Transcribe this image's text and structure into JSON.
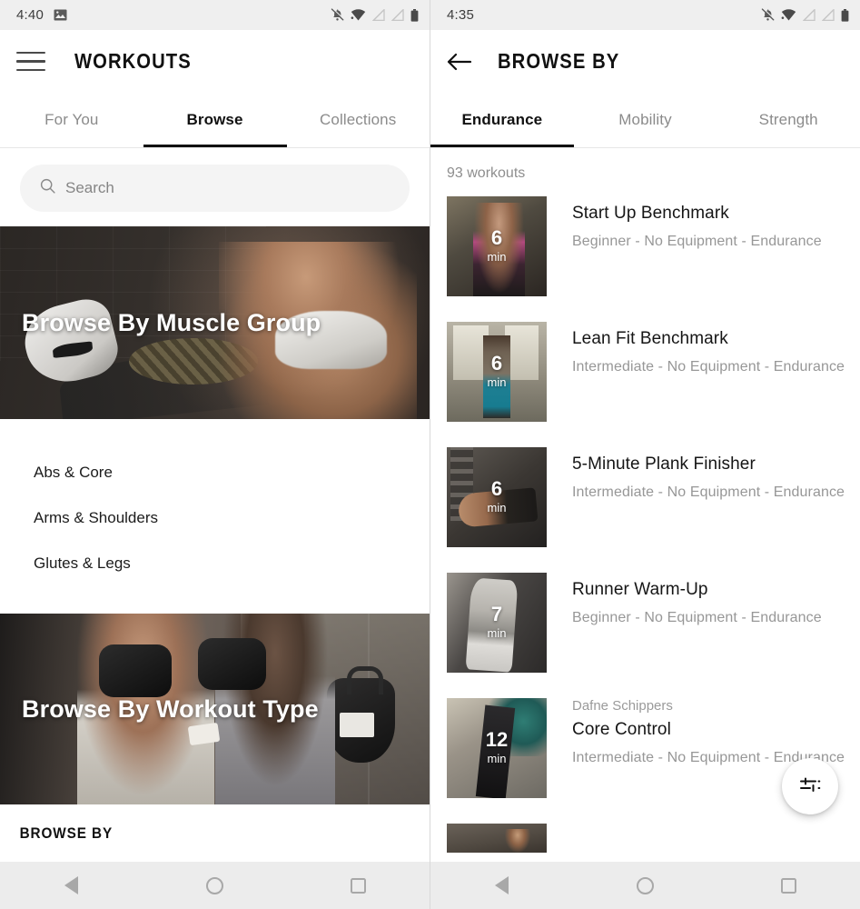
{
  "left_panel": {
    "status_bar": {
      "time": "4:40",
      "left_icons": [
        "screenshot-image-icon"
      ],
      "right_icons": [
        "notifications-off-icon",
        "wifi-icon",
        "sim1-no-signal-icon",
        "sim2-no-signal-icon",
        "battery-icon"
      ]
    },
    "app_bar": {
      "menu_icon": "hamburger-menu-icon",
      "title": "WORKOUTS"
    },
    "tabs": [
      {
        "label": "For You",
        "active": false
      },
      {
        "label": "Browse",
        "active": true
      },
      {
        "label": "Collections",
        "active": false
      }
    ],
    "search": {
      "icon": "search-icon",
      "placeholder": "Search",
      "value": ""
    },
    "hero_muscle": {
      "title": "Browse By Muscle Group"
    },
    "muscle_groups": [
      {
        "label": "Abs & Core"
      },
      {
        "label": "Arms & Shoulders"
      },
      {
        "label": "Glutes & Legs"
      }
    ],
    "hero_type": {
      "title": "Browse By Workout Type"
    },
    "bottom_partial_label": "BROWSE BY"
  },
  "right_panel": {
    "status_bar": {
      "time": "4:35",
      "right_icons": [
        "notifications-off-icon",
        "wifi-icon",
        "sim1-no-signal-icon",
        "sim2-no-signal-icon",
        "battery-icon"
      ]
    },
    "app_bar": {
      "back_icon": "back-arrow-icon",
      "title": "BROWSE BY"
    },
    "tabs": [
      {
        "label": "Endurance",
        "active": true
      },
      {
        "label": "Mobility",
        "active": false
      },
      {
        "label": "Strength",
        "active": false
      }
    ],
    "count_label": "93 workouts",
    "workouts": [
      {
        "duration": "6",
        "duration_unit": "min",
        "athlete": "",
        "title": "Start Up Benchmark",
        "meta": "Beginner - No Equipment - Endurance",
        "thumb_class": "t-a"
      },
      {
        "duration": "6",
        "duration_unit": "min",
        "athlete": "",
        "title": "Lean Fit Benchmark",
        "meta": "Intermediate - No Equipment - Endurance",
        "thumb_class": "t-b"
      },
      {
        "duration": "6",
        "duration_unit": "min",
        "athlete": "",
        "title": "5-Minute Plank Finisher",
        "meta": "Intermediate - No Equipment - Endurance",
        "thumb_class": "t-c"
      },
      {
        "duration": "7",
        "duration_unit": "min",
        "athlete": "",
        "title": "Runner Warm-Up",
        "meta": "Beginner - No Equipment - Endurance",
        "thumb_class": "t-d"
      },
      {
        "duration": "12",
        "duration_unit": "min",
        "athlete": "Dafne Schippers",
        "title": "Core Control",
        "meta": "Intermediate - No Equipment - Endurance",
        "thumb_class": "t-e"
      }
    ],
    "fab": {
      "icon": "filter-tune-icon",
      "label": ""
    }
  },
  "nav_bar": {
    "back": "back-triangle-icon",
    "home": "home-circle-icon",
    "recents": "recents-square-icon"
  },
  "colors": {
    "accent": "#111111",
    "status_bar_bg": "#efefef",
    "nav_bar_bg": "#ececec",
    "muted_text": "#8e8e8e",
    "search_bg": "#f4f4f4"
  }
}
